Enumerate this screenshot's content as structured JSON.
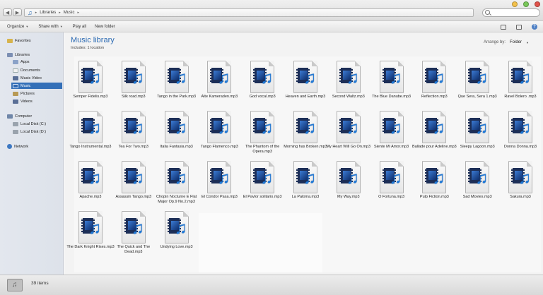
{
  "address": {
    "crumbs": [
      "Libraries",
      "Music"
    ],
    "search_placeholder": ""
  },
  "toolbar": {
    "organize": "Organize",
    "share_with": "Share with",
    "play_all": "Play all",
    "new_folder": "New folder"
  },
  "sidebar": {
    "items": [
      {
        "label": "Favorites",
        "icon": "star-icon"
      },
      {
        "label": "Libraries",
        "icon": "library-icon"
      },
      {
        "label": "Apps",
        "icon": "apps-icon"
      },
      {
        "label": "Documents",
        "icon": "documents-icon"
      },
      {
        "label": "Music Video",
        "icon": "video-icon"
      },
      {
        "label": "Music",
        "icon": "music-icon",
        "selected": true
      },
      {
        "label": "Pictures",
        "icon": "pictures-icon"
      },
      {
        "label": "Videos",
        "icon": "video-icon"
      },
      {
        "label": "Computer",
        "icon": "computer-icon"
      },
      {
        "label": "Local Disk (C:)",
        "icon": "disk-icon"
      },
      {
        "label": "Local Disk (D:)",
        "icon": "disk-icon"
      },
      {
        "label": "Network",
        "icon": "network-icon"
      }
    ]
  },
  "main": {
    "title": "Music library",
    "subtitle": "Includes: 1 location",
    "arrange_label": "Arrange by:",
    "arrange_value": "Folder"
  },
  "files": [
    "Semper Fidelis.mp3",
    "Silk road.mp3",
    "Tango in the Park.mp3",
    "Alte Kameraden.mp3",
    "God vocal.mp3",
    "Heaven and Earth.mp3",
    "Second Waltz.mp3",
    "The Blue Danube.mp3",
    "Reflection.mp3",
    "Que Sera, Sera 1.mp3",
    "Ravel Bolero .mp3",
    "Tango Instrumental.mp3",
    "Tea For Two.mp3",
    "Italia Fantasia.mp3",
    "Tango Flamenco.mp3",
    "The Phantom of the Opera.mp3",
    "Morning has Broken.mp3",
    "My Heart Will Go On.mp3",
    "Siente Mi Amor.mp3",
    "Ballade pour Adeline.mp3",
    "Sleepy Lagoon.mp3",
    "Donna Donna.mp3",
    "Apache.mp3",
    "Assassin Tango.mp3",
    "Chopin Nocturne E Flat Major Op.9 No.2.mp3",
    "El Condor Pasa.mp3",
    "El Pavlor solitario.mp3",
    "La Paloma.mp3",
    "My Way.mp3",
    "O Fortuna.mp3",
    "Pulp Fiction.mp3",
    "Sad Movies.mp3",
    "Sakura.mp3",
    "The Dark Knight Rises.mp3",
    "The Quick and The Dead.mp3",
    "Undying Love.mp3"
  ],
  "status": {
    "item_count": "39 items"
  }
}
